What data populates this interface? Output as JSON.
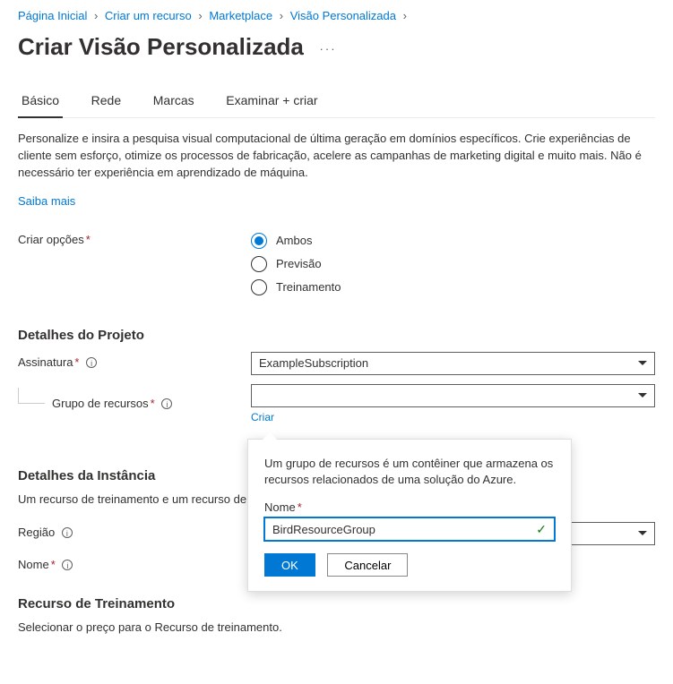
{
  "breadcrumb": [
    "Página Inicial",
    "Criar um recurso",
    "Marketplace",
    "Visão Personalizada"
  ],
  "title": "Criar Visão Personalizada",
  "tabs": [
    {
      "label": "Básico",
      "active": true
    },
    {
      "label": "Rede",
      "active": false
    },
    {
      "label": "Marcas",
      "active": false
    },
    {
      "label": "Examinar + criar",
      "active": false
    }
  ],
  "description": "Personalize e insira a pesquisa visual computacional de última geração em domínios específicos. Crie experiências de cliente sem esforço, otimize os processos de fabricação, acelere as campanhas de marketing digital e muito mais. Não é necessário ter experiência em aprendizado de máquina.",
  "learn_more": "Saiba mais",
  "create_options": {
    "label": "Criar opções",
    "items": [
      "Ambos",
      "Previsão",
      "Treinamento"
    ],
    "selected": 0
  },
  "project_details": {
    "heading": "Detalhes do Projeto",
    "subscription_label": "Assinatura",
    "subscription_value": "ExampleSubscription",
    "resource_group_label": "Grupo de recursos",
    "resource_group_value": "",
    "create_link": "Criar"
  },
  "instance_details": {
    "heading": "Detalhes da Instância",
    "description": "Um recurso de treinamento e um recurso de",
    "region_label": "Região",
    "region_value": "",
    "name_label": "Nome",
    "name_value": ""
  },
  "training_resource": {
    "heading": "Recurso de Treinamento",
    "description": "Selecionar o preço para o Recurso de treinamento."
  },
  "popup": {
    "description": "Um grupo de recursos é um contêiner que armazena os recursos relacionados de uma solução do Azure.",
    "name_label": "Nome",
    "name_value": "BirdResourceGroup",
    "ok": "OK",
    "cancel": "Cancelar"
  }
}
